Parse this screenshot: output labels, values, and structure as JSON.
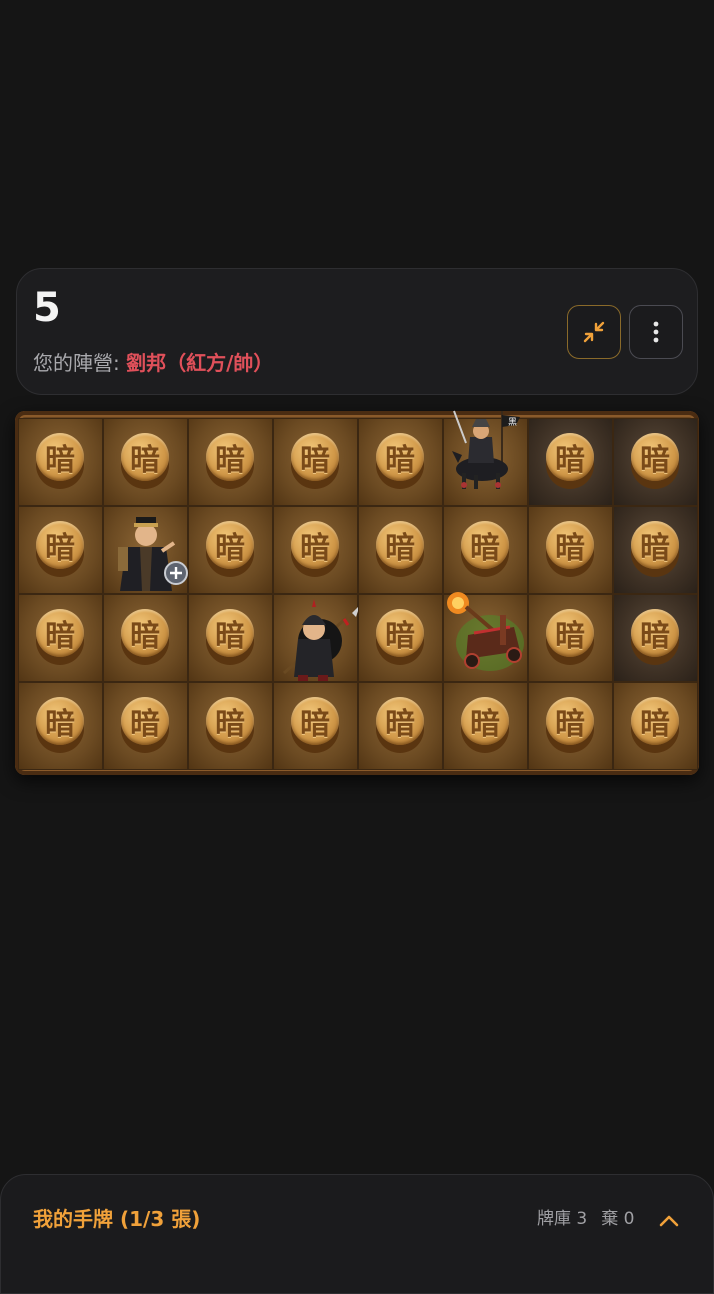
{
  "header": {
    "turn": "5",
    "faction_label": "您的陣營: ",
    "faction_value": "劉邦（紅方/帥）",
    "collapse_icon": "collapse-arrows-icon",
    "more_icon": "more-vertical-icon",
    "accent_color": "#f0a13a",
    "faction_color": "#e0505a"
  },
  "board": {
    "hidden_glyph": "暗",
    "rows": [
      [
        "hidden",
        "hidden",
        "hidden",
        "hidden",
        "hidden",
        "cavalry",
        "hidden",
        "hidden"
      ],
      [
        "hidden",
        "strategist",
        "hidden",
        "hidden",
        "hidden",
        "hidden",
        "hidden",
        "hidden"
      ],
      [
        "hidden",
        "hidden",
        "hidden",
        "spearman",
        "hidden",
        "catapult",
        "hidden",
        "hidden"
      ],
      [
        "hidden",
        "hidden",
        "hidden",
        "hidden",
        "hidden",
        "hidden",
        "hidden",
        "hidden"
      ]
    ],
    "dark_cells": [
      [
        0,
        6
      ],
      [
        0,
        7
      ],
      [
        1,
        7
      ],
      [
        2,
        7
      ]
    ],
    "cavalry_flag": "黑"
  },
  "hand": {
    "title": "我的手牌 (1/3 張)",
    "deck_label": "牌庫 3",
    "discard_label": "棄 0",
    "toggle_icon": "chevron-up-icon"
  }
}
